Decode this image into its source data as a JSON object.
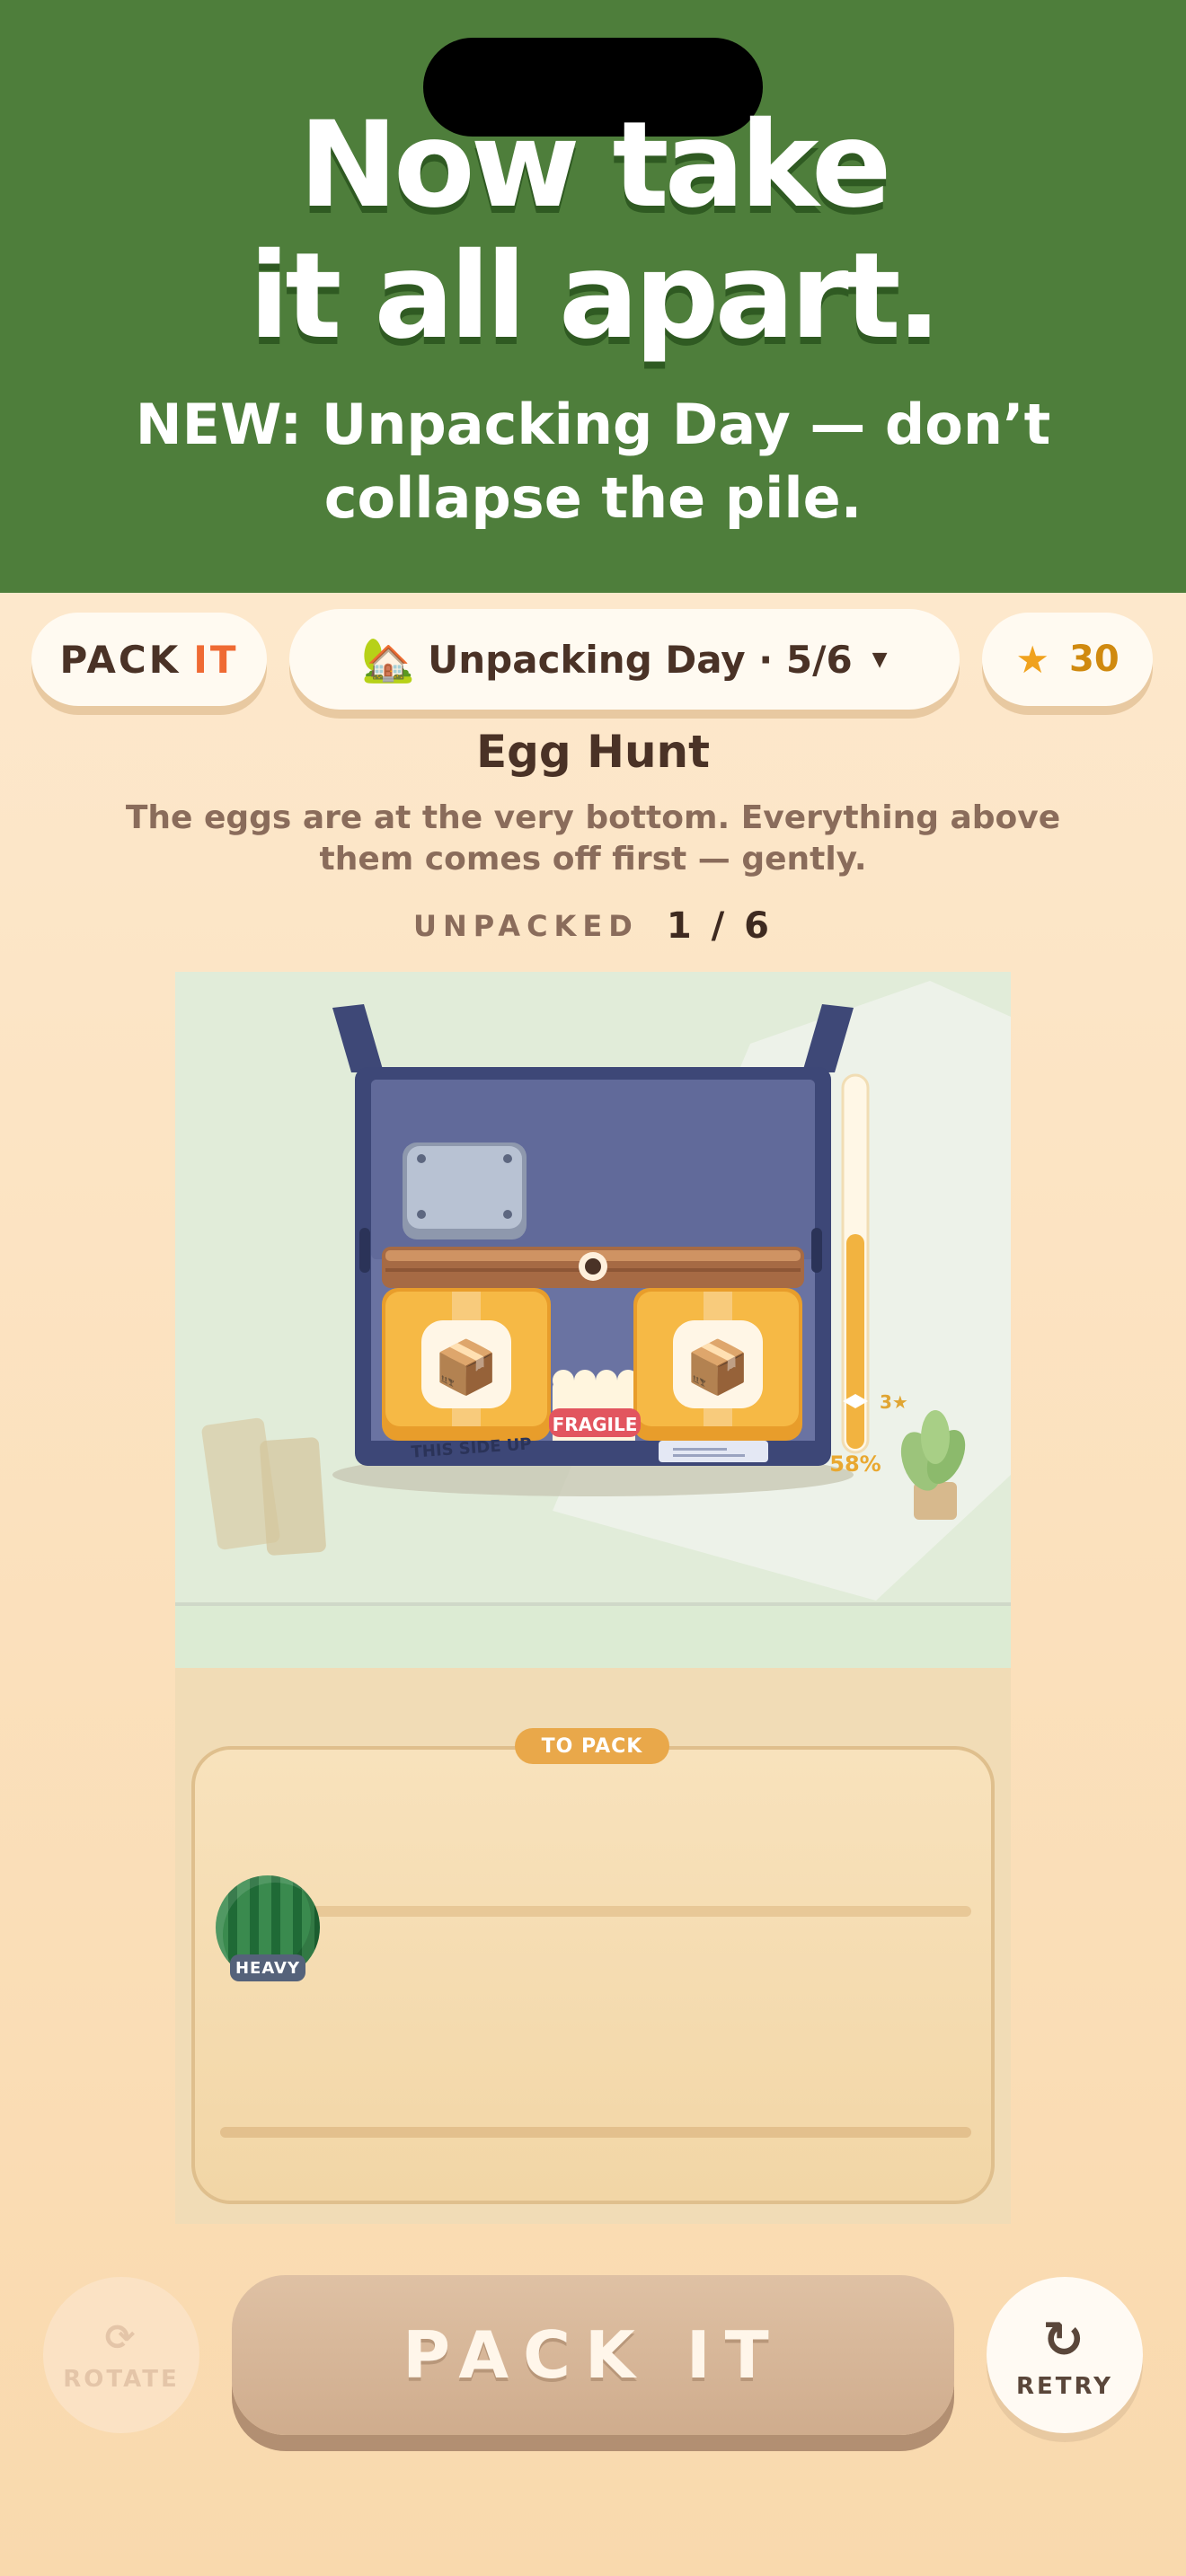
{
  "promo": {
    "headline_line1": "Now take",
    "headline_line2": "it all apart.",
    "subline_line1": "NEW: Unpacking Day — don’t",
    "subline_line2": "collapse the pile."
  },
  "topbar": {
    "logo_pack": "PACK",
    "logo_it": "IT",
    "level_icon": "🏡",
    "level_label": "Unpacking Day · 5/6",
    "level_caret": "▼",
    "star_icon": "★",
    "stars": "30"
  },
  "level": {
    "title": "Egg Hunt",
    "description": "The eggs are at the very bottom. Everything above them comes off first — gently.",
    "progress_label": "UNPACKED",
    "progress_value": "1 / 6"
  },
  "scene": {
    "fragile_label": "FRAGILE",
    "this_side_up": "THIS SIDE UP",
    "fill_percent": "58%",
    "fill_fraction": 0.58,
    "star_target": "3★",
    "to_pack_label": "TO PACK",
    "heavy_tag": "HEAVY"
  },
  "controls": {
    "rotate_icon": "⟳",
    "rotate_label": "ROTATE",
    "pack_label": "PACK IT",
    "retry_icon": "↻",
    "retry_label": "RETRY"
  },
  "colors": {
    "banner": "#4e7e3b",
    "accent_orange": "#ef6a33",
    "star": "#f0a21e",
    "box_navy": "#414c7d",
    "crate": "#f3b03f"
  }
}
